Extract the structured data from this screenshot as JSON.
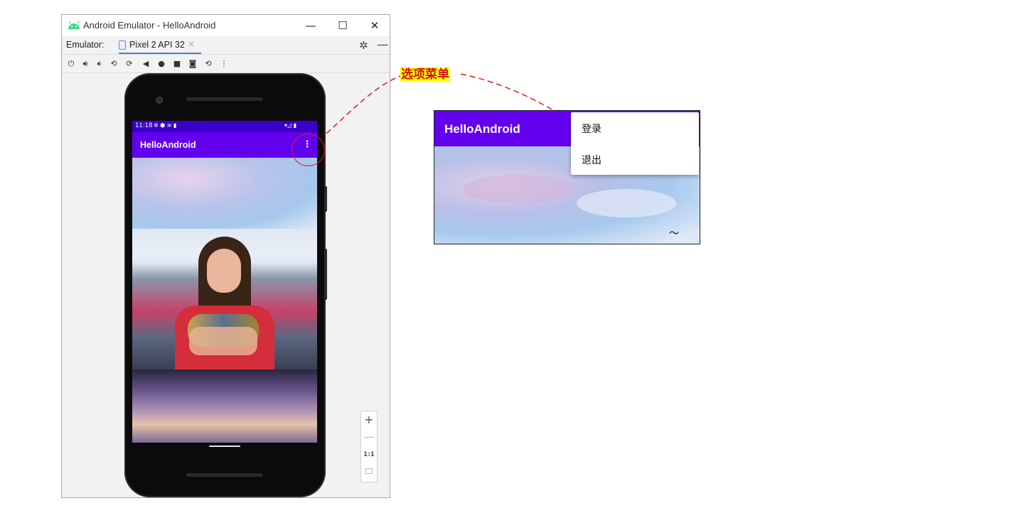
{
  "window": {
    "title": "Android Emulator - HelloAndroid",
    "minimize": "—",
    "maximize": "☐",
    "close": "✕"
  },
  "tabbar": {
    "label": "Emulator:",
    "tab": "Pixel 2 API 32",
    "tab_close": "×",
    "settings": "✲",
    "hide": "—"
  },
  "toolbar": {
    "items": [
      "power-icon",
      "volume-up-icon",
      "volume-down-icon",
      "rotate-left-icon",
      "rotate-right-icon",
      "back-icon",
      "home-icon",
      "overview-icon",
      "screenshot-icon",
      "snapshot-icon",
      "more-icon"
    ]
  },
  "phone": {
    "status_time": "11:18",
    "status_icons": "✲ ⬢ ≋ ▮",
    "status_right": "▾◿ ▮",
    "app_title": "HelloAndroid",
    "overflow": "⋮"
  },
  "zoom": {
    "in": "+",
    "out": "—",
    "one_to_one": "1:1"
  },
  "annotation": {
    "label": "选项菜单"
  },
  "menu_view": {
    "app_title": "HelloAndroid",
    "items": [
      "登录",
      "退出"
    ]
  },
  "colors": {
    "primary": "#6200ee",
    "primary_dark": "#3700b3",
    "annotation": "#e21c1c",
    "highlight": "#ffff00"
  }
}
